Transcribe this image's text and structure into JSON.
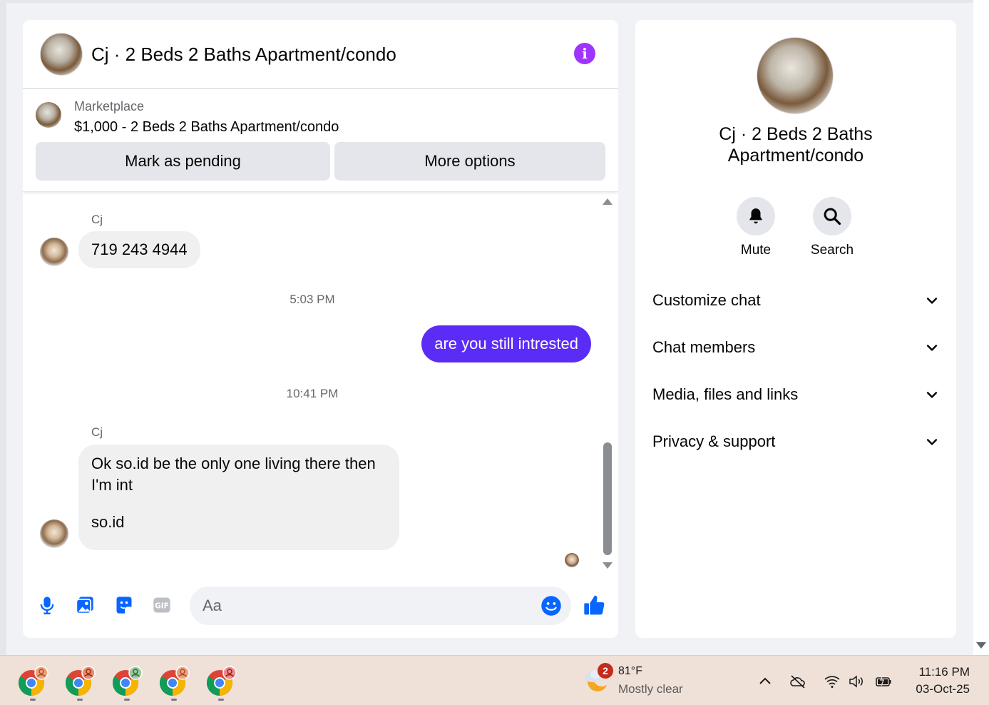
{
  "chat": {
    "title": "Cj · 2 Beds 2 Baths Apartment/condo",
    "listing": {
      "source": "Marketplace",
      "price_line": "$1,000 - 2 Beds 2 Baths Apartment/condo",
      "pending_label": "Mark as pending",
      "more_label": "More options"
    },
    "messages": {
      "m1_sender": "Cj",
      "m1_text": "719 243 4944",
      "ts1": "5:03 PM",
      "m2_text": "are you still intrested",
      "ts2": "10:41 PM",
      "m3_sender": "Cj",
      "m3_line1": "Ok so.id be the only one living there then",
      "m3_line2": "I'm int",
      "m3_line3": "so.id"
    },
    "composer": {
      "placeholder": "Aa"
    }
  },
  "info": {
    "name_line1": "Cj · 2 Beds 2 Baths",
    "name_line2": "Apartment/condo",
    "mute_label": "Mute",
    "search_label": "Search",
    "sections": [
      "Customize chat",
      "Chat members",
      "Media, files and links",
      "Privacy & support"
    ]
  },
  "taskbar": {
    "weather_badge": "2",
    "temperature": "81°F",
    "condition": "Mostly clear",
    "time": "11:16 PM",
    "date": "03-Oct-25"
  },
  "colors": {
    "accent": "#5b2cf5",
    "info_button": "#a033ff",
    "messenger_blue": "#0866ff"
  }
}
